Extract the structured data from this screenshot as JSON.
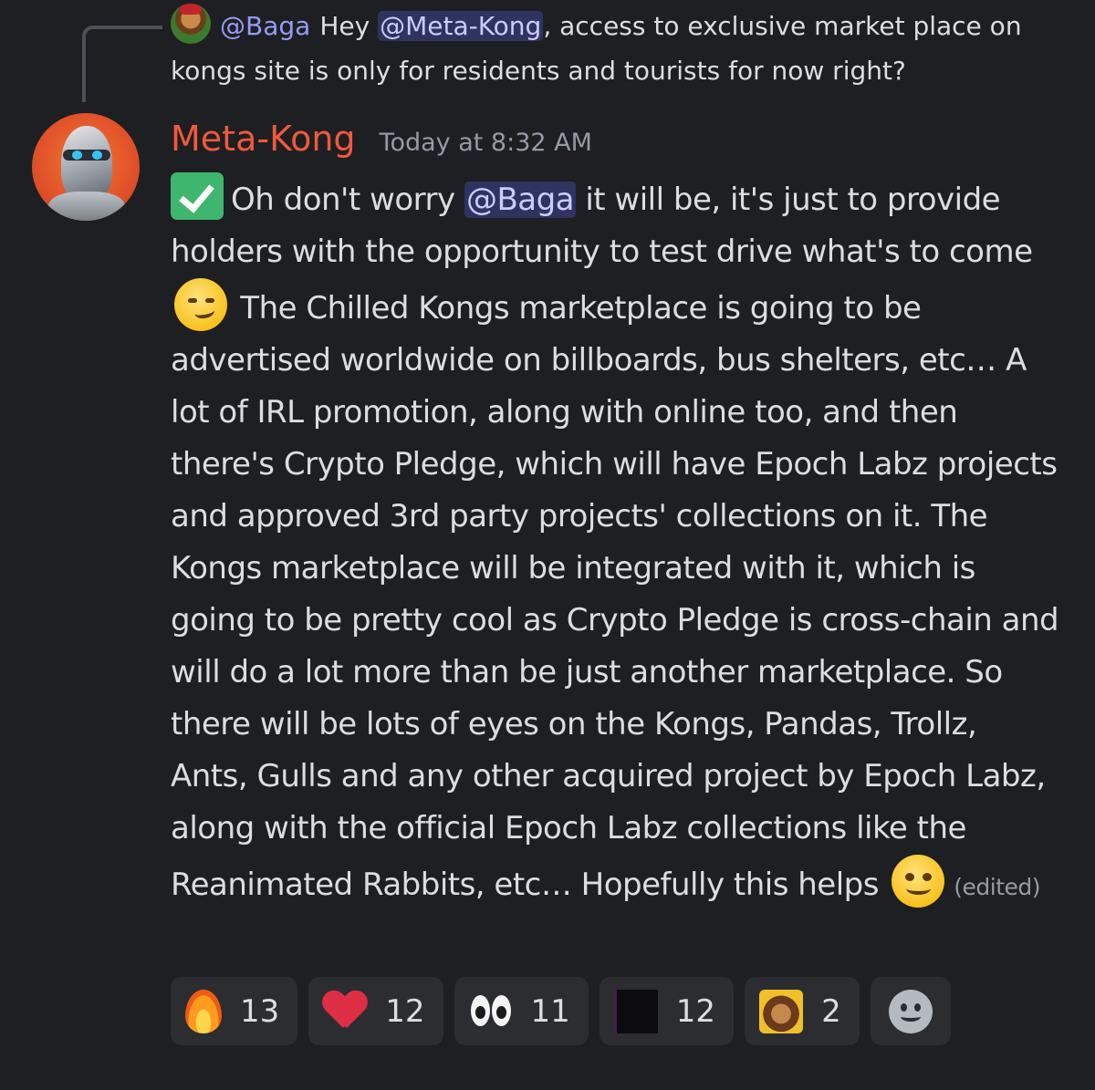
{
  "reply": {
    "username": "@Baga",
    "text_before": "Hey ",
    "mention": "@Meta-Kong",
    "text_after": ", access to exclusive market place on kongs site is only for residents and tourists for now right?"
  },
  "message": {
    "author": "Meta-Kong",
    "author_color": "#f0593c",
    "timestamp": "Today at 8:32 AM",
    "seg1": "Oh don't worry ",
    "mention": "@Baga",
    "seg2": " it will be, it's just to provide holders with the opportunity to test drive what's to come ",
    "seg3": " The Chilled Kongs marketplace is going to be advertised worldwide on billboards, bus shelters, etc… A lot of IRL promotion, along with online too, and then there's Crypto Pledge, which will have Epoch Labz projects and approved 3rd party projects' collections on it. The Kongs marketplace will be integrated with it, which is going to be pretty cool as Crypto Pledge is cross-chain and will do a lot more than be just another marketplace. So there will be lots of eyes on the Kongs, Pandas, Trollz, Ants, Gulls and any other acquired project by Epoch Labz, along with the official Epoch Labz collections like the Reanimated Rabbits, etc… Hopefully this helps ",
    "edited_label": "(edited)",
    "emojis": [
      "white-check-mark",
      "smirk",
      "slightly-smiling-face"
    ]
  },
  "reactions": [
    {
      "icon": "fire",
      "count": "13"
    },
    {
      "icon": "heart",
      "count": "12"
    },
    {
      "icon": "eyes",
      "count": "11"
    },
    {
      "icon": "custom-dark-emoji",
      "count": "12"
    },
    {
      "icon": "custom-kong-emoji",
      "count": "2"
    }
  ]
}
